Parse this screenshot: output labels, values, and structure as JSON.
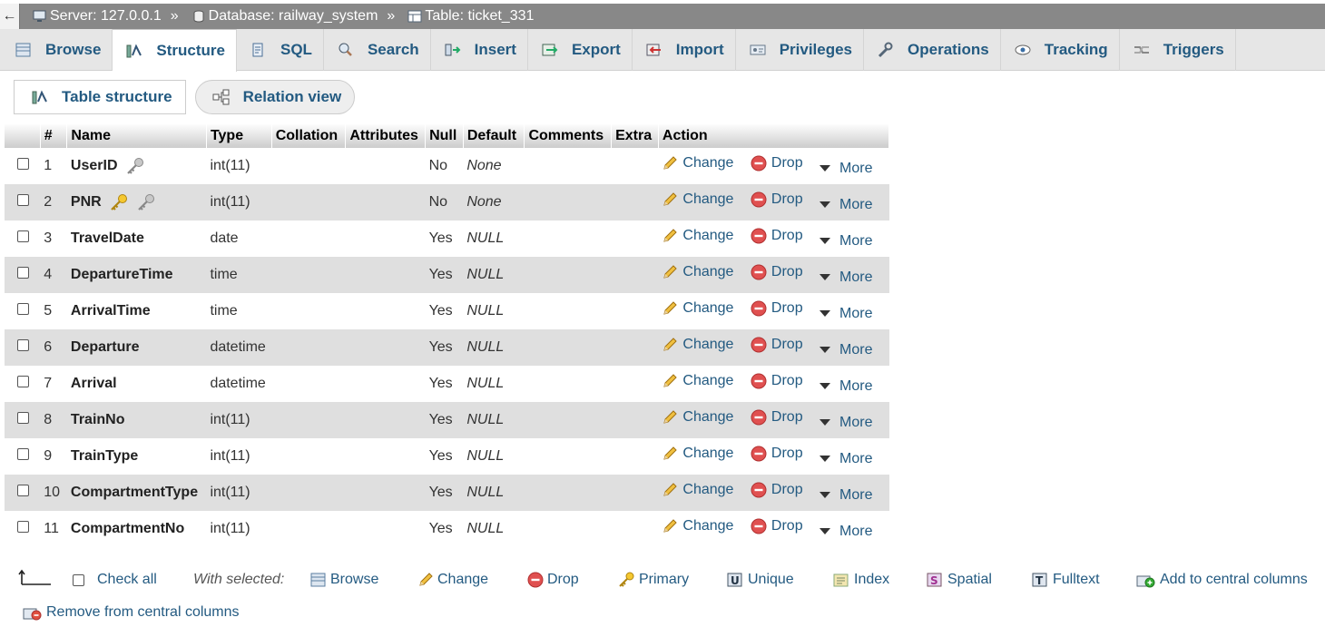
{
  "breadcrumb": {
    "back": "←",
    "server": "Server: 127.0.0.1",
    "database": "Database: railway_system",
    "table": "Table: ticket_331",
    "separator": "»"
  },
  "tabs": [
    {
      "label": "Browse",
      "icon": "browse-icon"
    },
    {
      "label": "Structure",
      "icon": "structure-icon",
      "active": true
    },
    {
      "label": "SQL",
      "icon": "sql-icon"
    },
    {
      "label": "Search",
      "icon": "search-icon"
    },
    {
      "label": "Insert",
      "icon": "insert-icon"
    },
    {
      "label": "Export",
      "icon": "export-icon"
    },
    {
      "label": "Import",
      "icon": "import-icon"
    },
    {
      "label": "Privileges",
      "icon": "privileges-icon"
    },
    {
      "label": "Operations",
      "icon": "wrench-icon"
    },
    {
      "label": "Tracking",
      "icon": "eye-icon"
    },
    {
      "label": "Triggers",
      "icon": "triggers-icon"
    }
  ],
  "subtabs": {
    "table_structure": "Table structure",
    "relation_view": "Relation view"
  },
  "columns": {
    "num": "#",
    "name": "Name",
    "type": "Type",
    "collation": "Collation",
    "attributes": "Attributes",
    "null": "Null",
    "default": "Default",
    "comments": "Comments",
    "extra": "Extra",
    "action": "Action"
  },
  "actions": {
    "change": "Change",
    "drop": "Drop",
    "more": "More"
  },
  "rows": [
    {
      "num": "1",
      "name": "UserID",
      "type": "int(11)",
      "null": "No",
      "default": "None",
      "keys": [
        "index"
      ]
    },
    {
      "num": "2",
      "name": "PNR",
      "type": "int(11)",
      "null": "No",
      "default": "None",
      "keys": [
        "primary",
        "index"
      ]
    },
    {
      "num": "3",
      "name": "TravelDate",
      "type": "date",
      "null": "Yes",
      "default": "NULL",
      "keys": []
    },
    {
      "num": "4",
      "name": "DepartureTime",
      "type": "time",
      "null": "Yes",
      "default": "NULL",
      "keys": []
    },
    {
      "num": "5",
      "name": "ArrivalTime",
      "type": "time",
      "null": "Yes",
      "default": "NULL",
      "keys": []
    },
    {
      "num": "6",
      "name": "Departure",
      "type": "datetime",
      "null": "Yes",
      "default": "NULL",
      "keys": []
    },
    {
      "num": "7",
      "name": "Arrival",
      "type": "datetime",
      "null": "Yes",
      "default": "NULL",
      "keys": []
    },
    {
      "num": "8",
      "name": "TrainNo",
      "type": "int(11)",
      "null": "Yes",
      "default": "NULL",
      "keys": []
    },
    {
      "num": "9",
      "name": "TrainType",
      "type": "int(11)",
      "null": "Yes",
      "default": "NULL",
      "keys": []
    },
    {
      "num": "10",
      "name": "CompartmentType",
      "type": "int(11)",
      "null": "Yes",
      "default": "NULL",
      "keys": []
    },
    {
      "num": "11",
      "name": "CompartmentNo",
      "type": "int(11)",
      "null": "Yes",
      "default": "NULL",
      "keys": []
    }
  ],
  "bottom": {
    "check_all": "Check all",
    "with_selected": "With selected:",
    "browse": "Browse",
    "change": "Change",
    "drop": "Drop",
    "primary": "Primary",
    "unique": "Unique",
    "index": "Index",
    "spatial": "Spatial",
    "fulltext": "Fulltext",
    "add_central": "Add to central columns",
    "remove_central": "Remove from central columns"
  },
  "colors": {
    "link": "#235a81",
    "tabbar": "#e6e6e6",
    "breadcrumb": "#888888",
    "row_alt": "#dfdfdf"
  }
}
